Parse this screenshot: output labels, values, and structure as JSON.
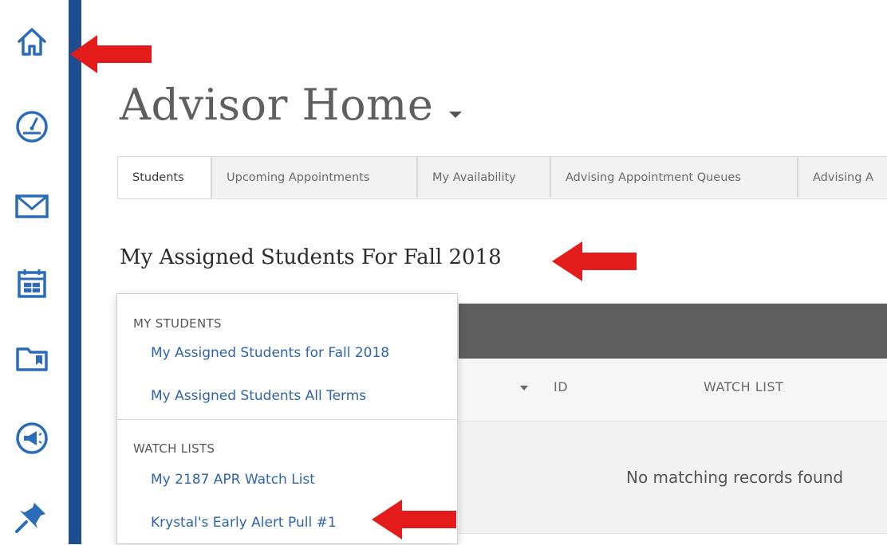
{
  "sidebar": {
    "icons": [
      "home-icon",
      "dashboard-icon",
      "mail-icon",
      "calendar-icon",
      "folder-icon",
      "announcement-icon",
      "pin-icon"
    ]
  },
  "header": {
    "title": "Advisor Home"
  },
  "tabs": [
    {
      "label": "Students",
      "active": true
    },
    {
      "label": "Upcoming Appointments",
      "active": false
    },
    {
      "label": "My Availability",
      "active": false
    },
    {
      "label": "Advising Appointment Queues",
      "active": false
    },
    {
      "label": "Advising A",
      "active": false
    }
  ],
  "section": {
    "heading": "My Assigned Students For Fall 2018"
  },
  "dropdown": {
    "group1_header": "MY STUDENTS",
    "group1_items": [
      "My Assigned Students for Fall 2018",
      "My Assigned Students All Terms"
    ],
    "group2_header": "WATCH LISTS",
    "group2_items": [
      "My 2187 APR Watch List",
      "Krystal's Early Alert Pull #1"
    ]
  },
  "table": {
    "columns": [
      "ID",
      "WATCH LIST"
    ],
    "empty_message": "No matching records found"
  },
  "colors": {
    "rail_bar": "#1f4d8f",
    "icon": "#2a6cb8",
    "link": "#2f64a6",
    "arrow": "#e41b1b",
    "table_header_dark": "#5e5e5e"
  }
}
